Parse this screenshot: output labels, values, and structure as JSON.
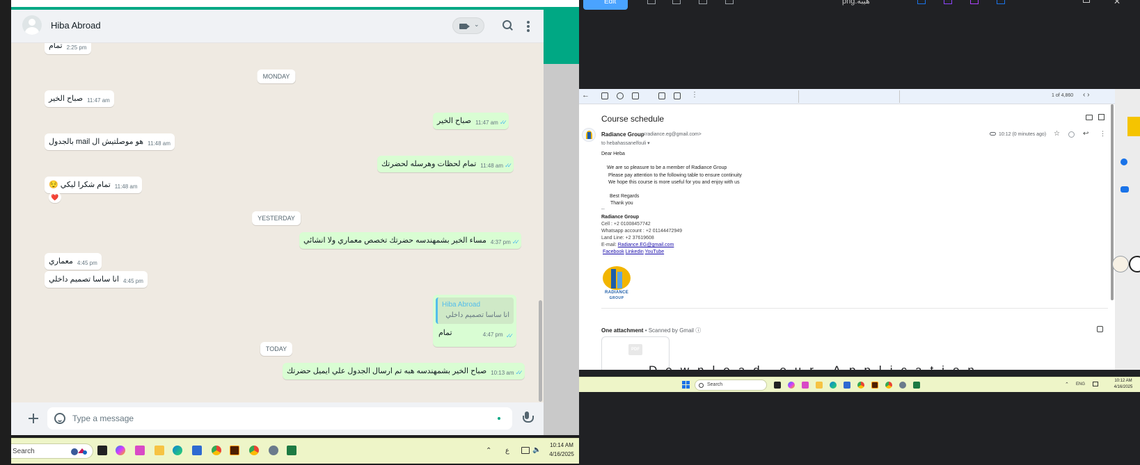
{
  "whatsapp": {
    "contact_name": "Hiba Abroad",
    "video_chevron": "⌄",
    "menu_dots": "⋮",
    "heart_reaction": "❤️",
    "date_chips": {
      "monday": "MONDAY",
      "yesterday": "YESTERDAY",
      "today": "TODAY"
    },
    "messages": {
      "m0": {
        "text": "تمام",
        "time": "2:25 pm"
      },
      "m1": {
        "text": "صباح الخير",
        "time": "11:47 am"
      },
      "m2": {
        "text": "صباح الخير",
        "time": "11:47 am"
      },
      "m3": {
        "text": "هو موصلتيش ال mail بالجدول",
        "time": "11:48 am"
      },
      "m4": {
        "text": "تمام لحظات وهرسله لحضرتك",
        "time": "11:48 am"
      },
      "m5": {
        "text": "تمام شكرا ليكي 😌",
        "time": "11:48 am"
      },
      "m6": {
        "text": "مساء الخير بشمهندسه حضرتك تخصص معماري ولا انشائي",
        "time": "4:37 pm"
      },
      "m7": {
        "text": "معماري",
        "time": "4:45 pm"
      },
      "m8": {
        "text": "انا ساسا تصميم داخلي",
        "time": "4:45 pm"
      },
      "m10": {
        "text": "صباح الخير بشمهندسه هبه تم ارسال الجدول علي ايميل حضرتك",
        "time": "10:13 am"
      }
    },
    "quoted": {
      "author": "Hiba Abroad",
      "quote_text": "انا ساسا تصميم داخلي",
      "reply_text": "تمام",
      "time": "4:47 pm"
    },
    "tick_glyph": "✓✓",
    "compose_placeholder": "Type a message"
  },
  "left_taskbar": {
    "search_label": "Search",
    "tray_up": "⌃",
    "lang": "ع",
    "volume": "🔈",
    "time": "10:14 AM",
    "date": "4/16/2025"
  },
  "right_window": {
    "edit_label": "Edit",
    "filename": "png.هيبة",
    "close_glyph": "✕"
  },
  "gmail": {
    "back_glyph": "←",
    "more_glyph": "⋮",
    "count": "1 of 4,860",
    "nav_glyph": "‹  ›",
    "subject": "Course schedule",
    "sender_name": "Radiance Group",
    "sender_email": "<radiance.eg@gmail.com>",
    "to_line": "to hebahassanelfouli ▾",
    "date": "10:12 (0 minutes ago)",
    "star_glyph": "☆",
    "reply_glyph": "↩",
    "body": {
      "greeting": "Dear  Heba",
      "line1": "We are so pleasure to be a member of Radiance Group",
      "line2": "Please pay attention to the following table to ensure continuity",
      "line3": "We hope this course is more useful for you and enjoy with us",
      "regards": "Best Regards",
      "thanks": "Thank you",
      "sig_dash": "--",
      "sig_name": "Radiance Group",
      "cell": "Cell : +2 01008457742",
      "whatsapp": "Whatsapp account : +2 01144472949",
      "landline": "Land Line: +2 37619608",
      "email_label": "E-mail: ",
      "email_value": "Radiance.EG@gmail.com",
      "link_facebook": "Facebook",
      "link_linkedin": "Linkedin",
      "link_youtube": "YouTube"
    },
    "logo_word1": "RADIANCE",
    "logo_word2": "GROUP",
    "attachment_title": "One attachment",
    "attachment_note": " • Scanned by Gmail ⓘ",
    "pdf_badge": "PDF",
    "overlay_text": "Download our Application"
  },
  "right_taskbar": {
    "search_label": "Search",
    "tray_up": "⌃",
    "lang": "ENG",
    "time": "10:12 AM",
    "date": "4/16/2025"
  },
  "colors": {
    "whatsapp_green": "#00a884",
    "outgoing_bubble": "#d9fdd3",
    "chat_bg": "#efeae2",
    "read_ticks": "#53bdeb",
    "taskbar": "#eef5c8",
    "gmail_toolbar": "#eaf1fb"
  }
}
